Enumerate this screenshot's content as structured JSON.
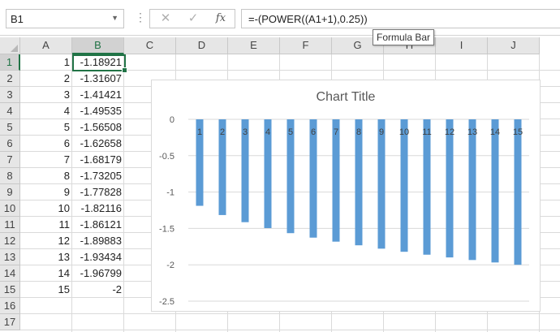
{
  "formula_bar": {
    "name_box": "B1",
    "formula": "=-(POWER((A1+1),0.25))",
    "tooltip": "Formula Bar",
    "fx_label": "fx"
  },
  "sheet": {
    "columns": [
      "A",
      "B",
      "C",
      "D",
      "E",
      "F",
      "G",
      "H",
      "I",
      "J"
    ],
    "selected_column": "B",
    "rows": [
      "1",
      "2",
      "3",
      "4",
      "5",
      "6",
      "7",
      "8",
      "9",
      "10",
      "11",
      "12",
      "13",
      "14",
      "15",
      "16",
      "17"
    ],
    "selected_row": "1",
    "col_a": [
      "1",
      "2",
      "3",
      "4",
      "5",
      "6",
      "7",
      "8",
      "9",
      "10",
      "11",
      "12",
      "13",
      "14",
      "15"
    ],
    "col_b": [
      "-1.18921",
      "-1.31607",
      "-1.41421",
      "-1.49535",
      "-1.56508",
      "-1.62658",
      "-1.68179",
      "-1.73205",
      "-1.77828",
      "-1.82116",
      "-1.86121",
      "-1.89883",
      "-1.93434",
      "-1.96799",
      "-2"
    ]
  },
  "chart_data": {
    "type": "bar",
    "title": "Chart Title",
    "categories": [
      "1",
      "2",
      "3",
      "4",
      "5",
      "6",
      "7",
      "8",
      "9",
      "10",
      "11",
      "12",
      "13",
      "14",
      "15"
    ],
    "values": [
      -1.18921,
      -1.31607,
      -1.41421,
      -1.49535,
      -1.56508,
      -1.62658,
      -1.68179,
      -1.73205,
      -1.77828,
      -1.82116,
      -1.86121,
      -1.89883,
      -1.93434,
      -1.96799,
      -2
    ],
    "ylim": [
      -2.5,
      0
    ],
    "yticks": [
      "0",
      "-0.5",
      "-1",
      "-1.5",
      "-2",
      "-2.5"
    ],
    "ytick_values": [
      0,
      -0.5,
      -1,
      -1.5,
      -2,
      -2.5
    ],
    "bar_color": "#5b9bd5",
    "grid": true
  },
  "colors": {
    "accent": "#217346"
  }
}
